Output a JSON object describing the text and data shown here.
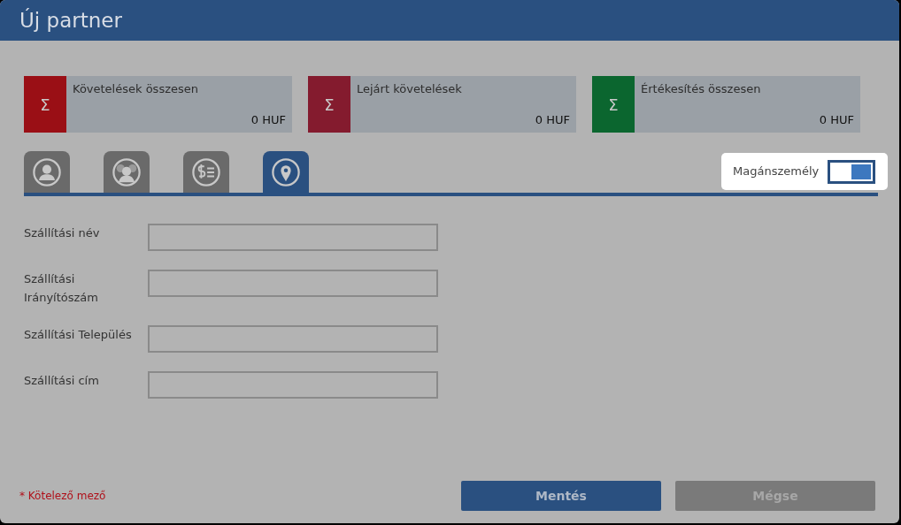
{
  "window": {
    "title": "Új partner"
  },
  "summary_cards": [
    {
      "label": "Követelések összesen",
      "value": "0 HUF",
      "icon": "Σ",
      "color": "#9a0f15"
    },
    {
      "label": "Lejárt követelések",
      "value": "0 HUF",
      "icon": "Σ",
      "color": "#841b2e"
    },
    {
      "label": "Értékesítés összesen",
      "value": "0 HUF",
      "icon": "Σ",
      "color": "#0b662f"
    }
  ],
  "tabs": [
    {
      "kind": "person",
      "selected": false
    },
    {
      "kind": "group",
      "selected": false
    },
    {
      "kind": "finance",
      "selected": false
    },
    {
      "kind": "location",
      "selected": true
    }
  ],
  "private_person_toggle": {
    "label": "Magánszemély",
    "on": true
  },
  "fields": [
    {
      "label": "Szállítási név"
    },
    {
      "label": "Szállítási Irányítószám"
    },
    {
      "label": "Szállítási Település"
    },
    {
      "label": "Szállítási cím"
    }
  ],
  "required_note": "* Kötelező mező",
  "buttons": [
    {
      "label": "Mentés",
      "kind": "primary"
    },
    {
      "label": "Mégse",
      "kind": "secondary"
    }
  ]
}
